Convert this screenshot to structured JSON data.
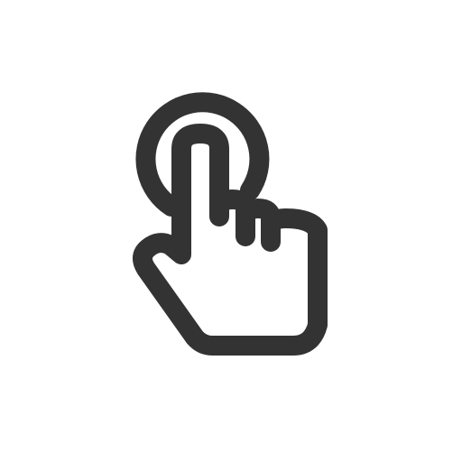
{
  "icon": {
    "name": "tap-gesture-icon",
    "color": "#333333",
    "background": "#ffffff"
  }
}
